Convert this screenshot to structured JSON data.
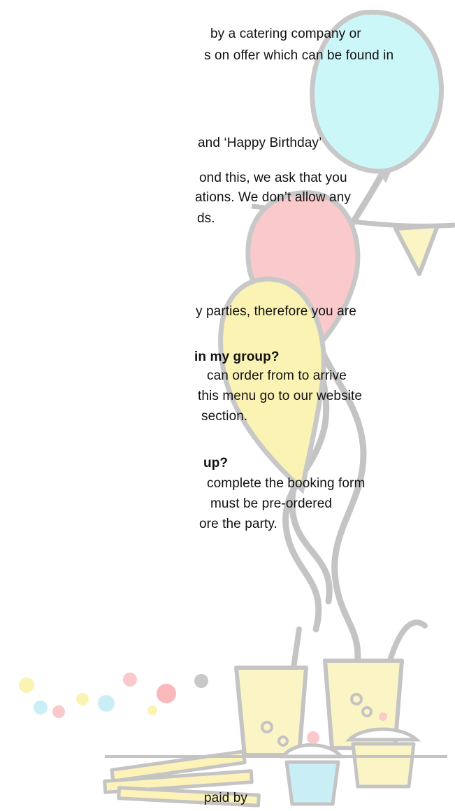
{
  "document": {
    "lines": [
      "by a catering company or",
      "s on offer which can be found in",
      "and ‘Happy Birthday’",
      "ond this, we ask that you",
      "ations. We don’t allow any",
      "ds.",
      "y parties, therefore you are",
      "in my group?",
      "can order from to arrive",
      "this menu go to our website",
      "section.",
      "up?",
      "complete the booking form",
      "must be pre-ordered",
      "ore the party.",
      "paid by"
    ]
  },
  "colors": {
    "balloon_blue": "#ccf7f8",
    "balloon_pink": "#f9c9cb",
    "balloon_yellow": "#fbf3b4",
    "sketch_gray": "#bdbdbd",
    "cup_yellow": "#fbf5c6",
    "cupcake_blue": "#c9eef6",
    "fries_yellow": "#fdf3b8"
  }
}
